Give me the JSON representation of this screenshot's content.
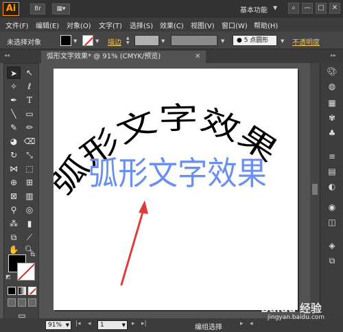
{
  "app": {
    "logo": "Ai",
    "workspace": "基本功能",
    "window_buttons": [
      "—",
      "□",
      "✕"
    ]
  },
  "menu": [
    "文件(F)",
    "编辑(E)",
    "对象(O)",
    "文字(T)",
    "选择(S)",
    "效果(C)",
    "视图(V)",
    "窗口(W)",
    "帮助(H)"
  ],
  "control": {
    "selection_status": "未选择对象",
    "stroke_label": "描边",
    "brush": "5 点圆形",
    "opacity_label": "不透明度"
  },
  "document": {
    "tab_title": "弧形文字效果* @ 91% (CMYK/预览)",
    "close": "✕"
  },
  "artwork": {
    "arc_text": "弧形文字效果",
    "straight_text": "弧形文字效果",
    "arc_color": "#000000",
    "straight_color": "#6a8ff0",
    "arrow_color": "#e23a3a"
  },
  "statusbar": {
    "zoom": "91%",
    "artboard": "1",
    "status": "编组选择"
  },
  "watermark": {
    "brand": "Baidu 经验",
    "url": "jingyan.baidu.com"
  }
}
